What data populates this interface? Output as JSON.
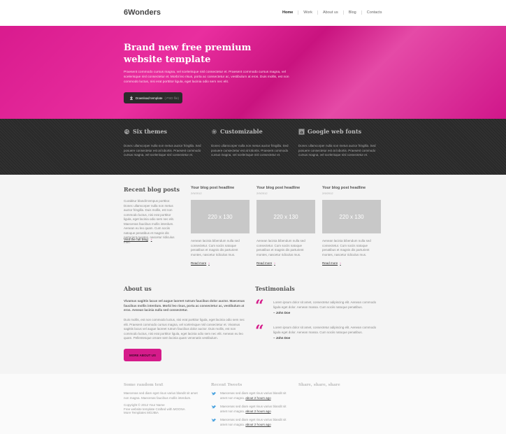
{
  "header": {
    "logo": "6Wonders",
    "nav": [
      "Home",
      "Work",
      "About us",
      "Blog",
      "Contacts"
    ]
  },
  "hero": {
    "title": "Brand new free premium website template",
    "text": "Praesent commodo cursus magna, vel scelerisque nisl consectetur et. Praesent commodo cursus magna, vel scelerisque nisl consectetur et. Morbi leo risus, porta ac consectetur ac, vestibulum at eros. Duis mollis, est non commodo luctus, nisi erat porttitor ligula, eget lacinia odio sem nec elit.",
    "button_label": "Download template",
    "button_sub": "(.PSD file)"
  },
  "features": [
    {
      "title": "Six themes",
      "icon": "palette-icon",
      "text": "Donec ullamcorper nulla non metus auctor fringilla. Sed posuere consectetur est at lobortis. Praesent commodo cursus magna, vel scelerisque nisl consectetur et."
    },
    {
      "title": "Customizable",
      "icon": "gear-icon",
      "text": "Donec ullamcorper nulla non metus auctor fringilla. Sed posuere consectetur est at lobortis. Praesent commodo cursus magna, vel scelerisque nisl consectetur et."
    },
    {
      "title": "Google web fonts",
      "icon": "font-icon",
      "text": "Donec ullamcorper nulla non metus auctor fringilla. Sed posuere consectetur est at lobortis. Praesent commodo cursus magna, vel scelerisque nisl consectetur et."
    }
  ],
  "blog": {
    "title": "Recent blog posts",
    "intro": "Curabitur blandit tempus porttitor. Donec ullamcorper nulla non metus auctor fringilla. Duis mollis, est non commodo luctus, nisi erat porttitor ligula, eget lacinia odio sem nec elit. Maecenas faucibus mollis interdum. Aenean eu leo quam. Cum sociis natoque penatibus et magnis dis parturient montes, nascetur ridiculus mus.",
    "visit_link": "Visit the full blog",
    "posts": [
      {
        "title": "Your blog post headline",
        "date": "2/9/2012",
        "placeholder": "220 x 130",
        "text": "Aenean lacinia bibendum nulla sed consectetur. Cum sociis natoque penatibus et magnis dis parturient montes, nascetur ridiculus mus.",
        "read_more": "Read more"
      },
      {
        "title": "Your blog post headline",
        "date": "2/9/2012",
        "placeholder": "220 x 130",
        "text": "Aenean lacinia bibendum nulla sed consectetur. Cum sociis natoque penatibus et magnis dis parturient montes, nascetur ridiculus mus.",
        "read_more": "Read more"
      },
      {
        "title": "Your blog post headline",
        "date": "2/9/2012",
        "placeholder": "220 x 130",
        "text": "Aenean lacinia bibendum nulla sed consectetur. Cum sociis natoque penatibus et magnis dis parturient montes, nascetur ridiculus mus.",
        "read_more": "Read more"
      }
    ]
  },
  "about": {
    "title": "About us",
    "bold_text": "Vivamus sagittis lacus vel augue laoreet rutrum faucibus dolor auctor. Maecenas faucibus mollis interdum. Morbi leo risus, porta ac consectetur ac, vestibulum at eros. Aenean lacinia nulla sed consectetur.",
    "text": "Duis mollis, est non commodo luctus, nisi erat porttitor ligula, eget lacinia odio sem nec elit. Praesent commodo cursus magna, vel scelerisque nisl consectetur et. Vivamus sagittis lacus vel augue laoreet rutrum faucibus dolor auctor. Duis mollis, est non commodo luctus, nisi erat porttitor ligula, eget lacinia odio sem nec elit. Aenean eu leo quam. Pellentesque ornare sem lacinia quam venenatis vestibulum.",
    "button_label": "MORE ABOUT US"
  },
  "testimonials": {
    "title": "Testimonials",
    "items": [
      {
        "text": "Lorem ipsum dolor sit amet, consectetur adipiscing elit. Aenean commodo ligula eget dolor. Aenean massa. Cum sociis natoque penatibus.",
        "author": "– John Doe"
      },
      {
        "text": "Lorem ipsum dolor sit amet, consectetur adipiscing elit. Aenean commodo ligula eget dolor. Aenean massa. Cum sociis natoque penatibus.",
        "author": "– John Doe"
      }
    ]
  },
  "footer": {
    "random": {
      "title": "Some random text",
      "text": "Maecenas sed diam eget risus varius blandit sit amet non magna. Maecenas faucibus mollis interdum.",
      "copyright": "Copyright © 2012 Your Name",
      "line2": "Free website template Crafted with MOONA",
      "line3": "More Templates MOJIBA"
    },
    "tweets": {
      "title": "Recent Tweets",
      "items": [
        {
          "text": "Maecenas sed diam eget risus varius blandit sit amet non magna.",
          "time": "about 2 hours ago"
        },
        {
          "text": "Maecenas sed diam eget risus varius blandit sit amet non magna.",
          "time": "about 2 hours ago"
        },
        {
          "text": "Maecenas sed diam eget risus varius blandit sit amet non magna.",
          "time": "about 2 hours ago"
        }
      ]
    },
    "share": {
      "title": "Share, share, share"
    }
  },
  "colors": {
    "accent": "#d51b8a",
    "dark": "#2e2e2e"
  }
}
